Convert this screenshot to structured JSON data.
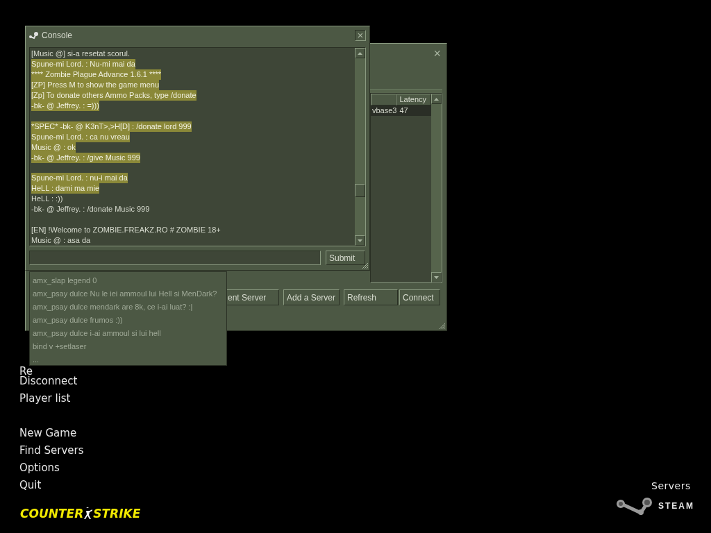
{
  "main_menu": {
    "items": [
      {
        "kind": "item",
        "label": "Re"
      },
      {
        "kind": "item",
        "label": "Disconnect"
      },
      {
        "kind": "item",
        "label": "Player list"
      },
      {
        "kind": "gap"
      },
      {
        "kind": "item",
        "label": "New Game"
      },
      {
        "kind": "item",
        "label": "Find Servers"
      },
      {
        "kind": "item",
        "label": "Options"
      },
      {
        "kind": "item",
        "label": "Quit"
      }
    ]
  },
  "logo": {
    "left": "COUNTER",
    "right": "STRIKE"
  },
  "corner": {
    "link": "Servers",
    "brand": "STEAM"
  },
  "server_window": {
    "close": "×",
    "columns": [
      "",
      "Latency"
    ],
    "rows": [
      {
        "cells": [
          "vbase3",
          "47"
        ],
        "selected": true
      }
    ],
    "buttons": [
      "ent Server",
      "Add a Server",
      "Refresh",
      "Connect"
    ]
  },
  "console": {
    "title": "Console",
    "close": "×",
    "lines": [
      {
        "kind": "text",
        "text": "[Music @] si-a resetat scorul.",
        "highlighted": false
      },
      {
        "kind": "text",
        "text": "Spune-mi Lord. :  Nu-mi mai da",
        "highlighted": true
      },
      {
        "kind": "text",
        "text": "**** Zombie Plague Advance 1.6.1 ****",
        "highlighted": true
      },
      {
        "kind": "text",
        "text": "[ZP] Press M to show the game menu",
        "highlighted": true
      },
      {
        "kind": "text",
        "text": "[Zp] To donate others Ammo Packs, type /donate",
        "highlighted": true
      },
      {
        "kind": "text",
        "text": "-bk- @ Jeffrey. :  =)))",
        "highlighted": true
      },
      {
        "kind": "blank"
      },
      {
        "kind": "text",
        "text": "*SPEC* -bk- @ K3nT>,>H[D] :  /donate lord 999",
        "highlighted": true
      },
      {
        "kind": "text",
        "text": "Spune-mi Lord. :  ca nu vreau",
        "highlighted": true
      },
      {
        "kind": "text",
        "text": "Music @ :  ok",
        "highlighted": true
      },
      {
        "kind": "text",
        "text": "-bk- @ Jeffrey. :  /give Music 999",
        "highlighted": true
      },
      {
        "kind": "blank"
      },
      {
        "kind": "text",
        "text": "Spune-mi Lord. :  nu-i mai da",
        "highlighted": true
      },
      {
        "kind": "text",
        "text": "HeLL :  dami ma mie",
        "highlighted": true
      },
      {
        "kind": "text",
        "text": "HeLL :  :))",
        "highlighted": false
      },
      {
        "kind": "text",
        "text": "-bk- @ Jeffrey. :  /donate Music 999",
        "highlighted": false
      },
      {
        "kind": "blank"
      },
      {
        "kind": "text",
        "text": "[EN] !Welcome to ZOMBIE.FREAKZ.RO # ZOMBIE 18+",
        "highlighted": false
      },
      {
        "kind": "text",
        "text": "Music @ :  asa da",
        "highlighted": false
      }
    ],
    "submit": "Submit",
    "history": [
      "amx_slap legend 0",
      "amx_psay dulce Nu le iei ammoul lui Hell si MenDark?",
      "amx_psay dulce mendark are 8k, ce i-ai luat? :|",
      "amx_psay dulce frumos :))",
      "amx_psay dulce i-ai ammoul si lui hell",
      "bind v +setlaser",
      "..."
    ]
  }
}
